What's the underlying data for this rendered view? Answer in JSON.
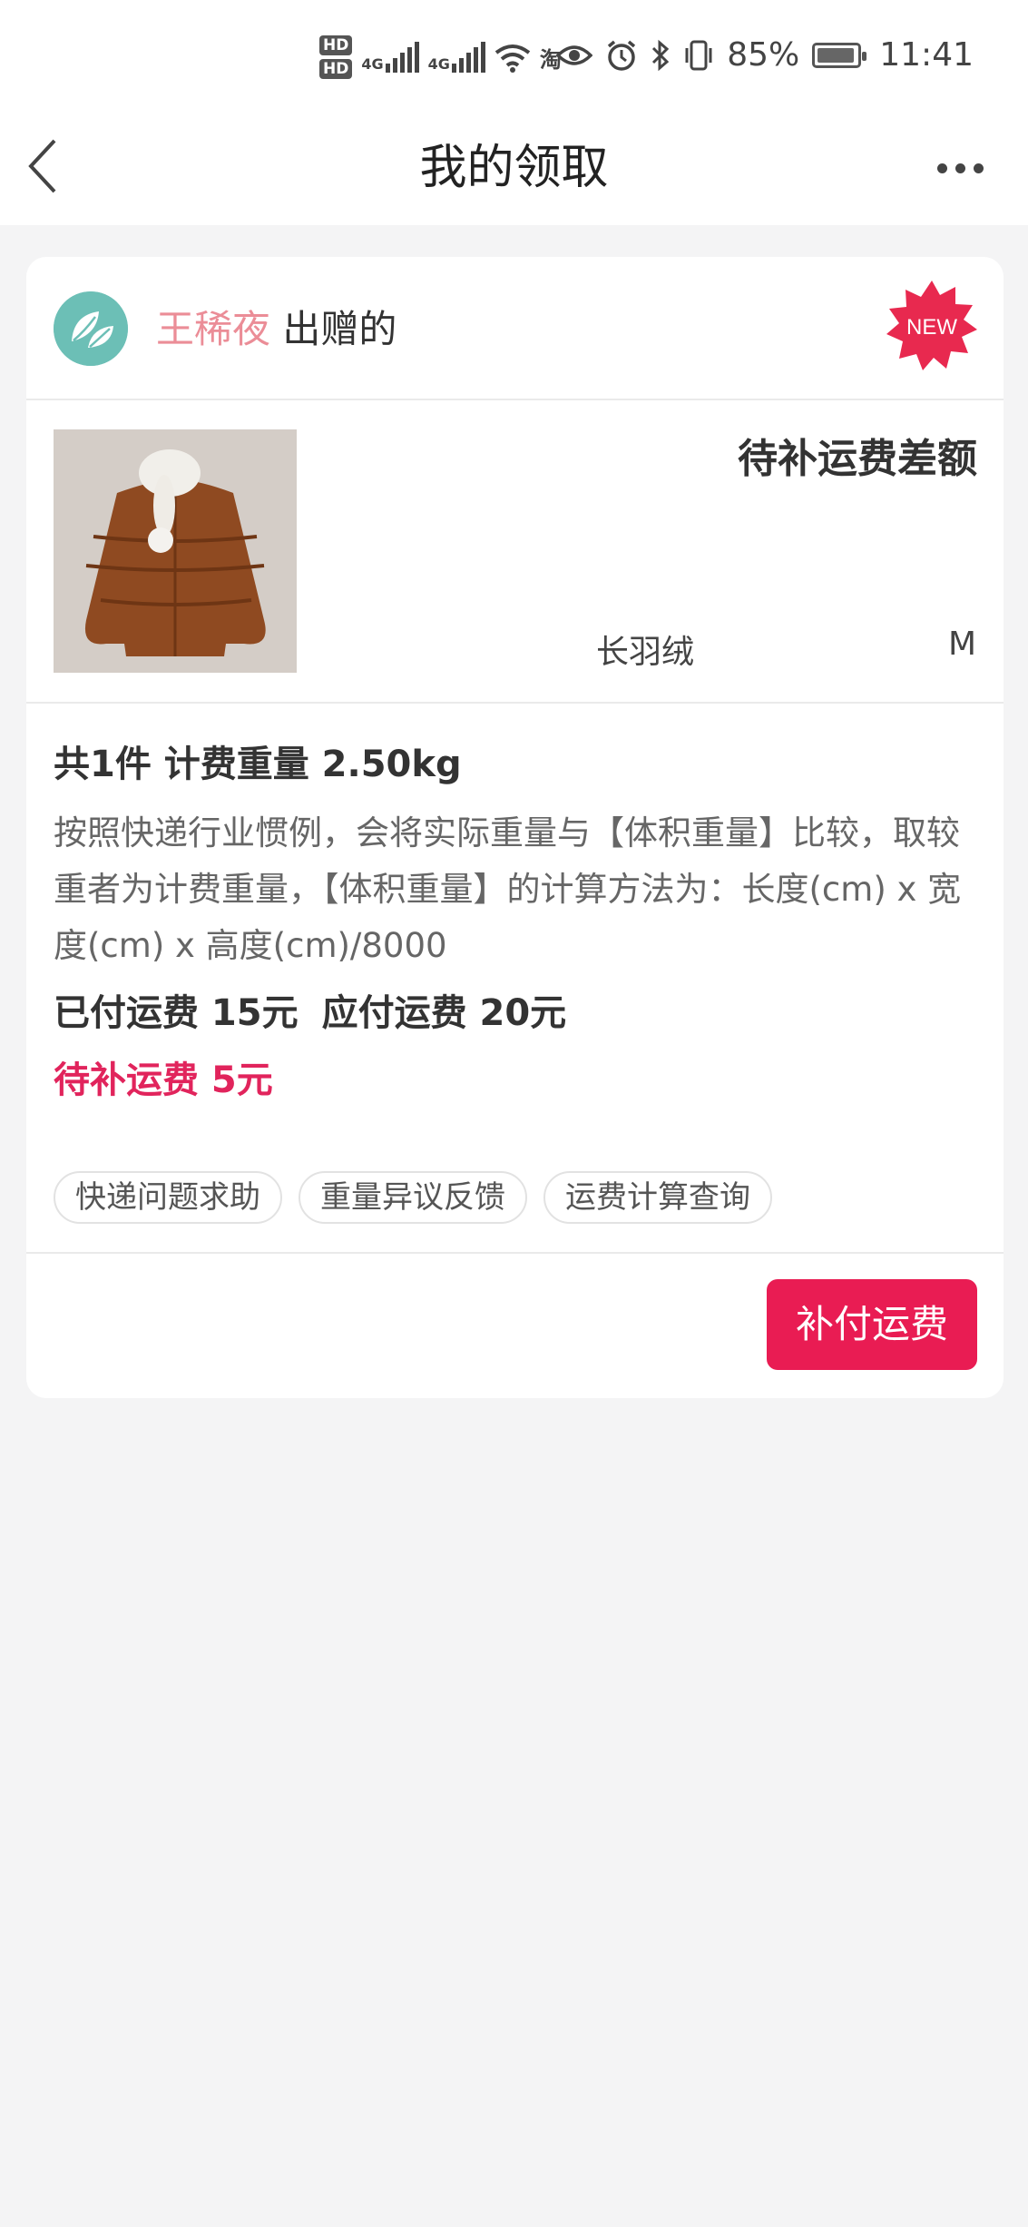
{
  "status_bar": {
    "hd1": "HD",
    "hd2": "HD",
    "net1": "4G",
    "net2": "4G",
    "app_icon": "淘",
    "battery_pct": "85%",
    "time": "11:41",
    "icons": [
      "eye-icon",
      "alarm-icon",
      "bluetooth-icon",
      "vibrate-icon",
      "battery-icon",
      "wifi-icon",
      "signal-icon"
    ]
  },
  "nav": {
    "title": "我的领取",
    "back_icon": "chevron-left-icon",
    "more_icon": "more-horizontal-icon"
  },
  "card": {
    "giver_name": "王稀夜",
    "giver_suffix": "出赠的",
    "badge": "NEW",
    "status": "待补运费差额",
    "product_name": "长羽绒",
    "product_size": "M",
    "count_line": "共1件 计费重量 2.50kg",
    "description": "按照快递行业惯例，会将实际重量与【体积重量】比较，取较重者为计费重量，【体积重量】的计算方法为：长度(cm) x 宽度(cm) x 高度(cm)/8000",
    "paid": "已付运费 15元",
    "payable": "应付运费 20元",
    "due": "待补运费 5元",
    "tags": [
      "快递问题求助",
      "重量异议反馈",
      "运费计算查询"
    ],
    "pay_button": "补付运费"
  },
  "colors": {
    "accent": "#e91c53",
    "giver_name": "#eb8d97",
    "avatar": "#6cbfb6",
    "page_bg": "#f4f4f5"
  }
}
